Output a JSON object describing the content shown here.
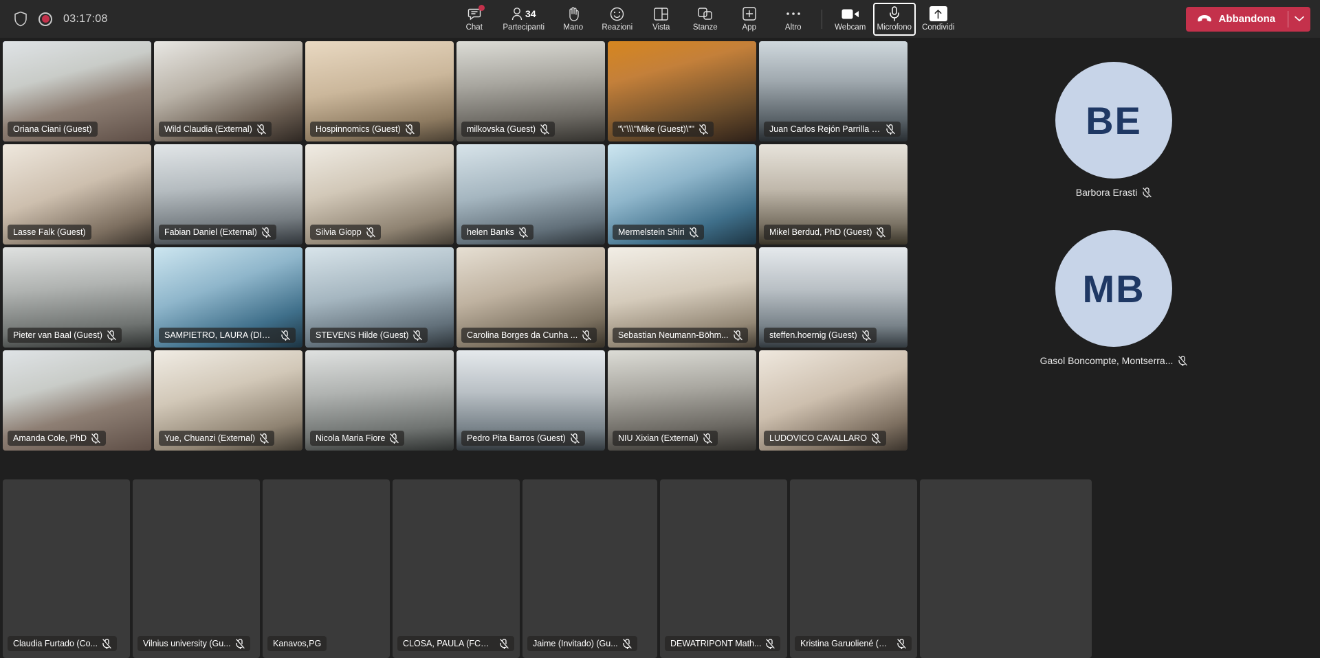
{
  "topbar": {
    "security_icon": "shield-icon",
    "recording_icon": "record-icon",
    "timer": "03:17:08",
    "buttons": [
      {
        "id": "chat",
        "label": "Chat",
        "icon": "chat-icon",
        "badge": true
      },
      {
        "id": "participants",
        "label": "Partecipanti",
        "icon": "people-icon",
        "count": "34"
      },
      {
        "id": "hand",
        "label": "Mano",
        "icon": "raise-hand-icon"
      },
      {
        "id": "reactions",
        "label": "Reazioni",
        "icon": "emoji-icon"
      },
      {
        "id": "view",
        "label": "Vista",
        "icon": "layout-grid-icon"
      },
      {
        "id": "rooms",
        "label": "Stanze",
        "icon": "breakout-rooms-icon"
      },
      {
        "id": "apps",
        "label": "App",
        "icon": "plus-box-icon"
      },
      {
        "id": "more",
        "label": "Altro",
        "icon": "ellipsis-icon"
      }
    ],
    "media": [
      {
        "id": "camera",
        "label": "Webcam",
        "icon": "video-camera-icon",
        "focused": false
      },
      {
        "id": "microphone",
        "label": "Microfono",
        "icon": "microphone-icon",
        "focused": true
      },
      {
        "id": "share",
        "label": "Condividi",
        "icon": "share-screen-icon",
        "focused": false
      }
    ],
    "leave": {
      "label": "Abbandona",
      "icon": "hangup-icon",
      "chevron": "chevron-down-icon",
      "color": "#c4314b"
    }
  },
  "grid": {
    "rows": [
      [
        {
          "name": "Oriana Ciani (Guest)",
          "muted": false,
          "active": true,
          "face": "f1"
        },
        {
          "name": "Wild Claudia (External)",
          "muted": true,
          "active": false,
          "face": "f2"
        },
        {
          "name": "Hospinnomics (Guest)",
          "muted": true,
          "active": false,
          "face": "f3"
        },
        {
          "name": "milkovska (Guest)",
          "muted": true,
          "active": false,
          "face": "f4"
        },
        {
          "name": "\"\\\"\\\\\\\"Mike (Guest)\\\"\"",
          "muted": true,
          "active": false,
          "face": "f5"
        },
        {
          "name": "Juan Carlos Rejón Parrilla (...",
          "muted": true,
          "active": false,
          "face": "f6"
        }
      ],
      [
        {
          "name": "Lasse Falk (Guest)",
          "muted": false,
          "active": false,
          "face": "f7"
        },
        {
          "name": "Fabian Daniel (External)",
          "muted": true,
          "active": false,
          "face": "f8"
        },
        {
          "name": "Silvia Giopp",
          "muted": true,
          "active": false,
          "face": "f9"
        },
        {
          "name": "helen Banks",
          "muted": true,
          "active": false,
          "face": "f10"
        },
        {
          "name": "Mermelstein Shiri",
          "muted": true,
          "active": false,
          "face": "f11"
        },
        {
          "name": "Mikel Berdud, PhD (Guest)",
          "muted": true,
          "active": false,
          "face": "f12"
        }
      ],
      [
        {
          "name": "Pieter van Baal (Guest)",
          "muted": true,
          "active": false,
          "face": "f13"
        },
        {
          "name": "SAMPIETRO, LAURA (DIRI...",
          "muted": true,
          "active": false,
          "face": "f11"
        },
        {
          "name": "STEVENS Hilde (Guest)",
          "muted": true,
          "active": false,
          "face": "f10"
        },
        {
          "name": "Carolina Borges da Cunha ...",
          "muted": true,
          "active": false,
          "face": "f14"
        },
        {
          "name": "Sebastian Neumann-Böhm...",
          "muted": true,
          "active": false,
          "face": "f15"
        },
        {
          "name": "steffen.hoernig (Guest)",
          "muted": true,
          "active": false,
          "face": "f16"
        }
      ],
      [
        {
          "name": "Amanda Cole, PhD",
          "muted": true,
          "active": false,
          "face": "f1"
        },
        {
          "name": "Yue, Chuanzi (External)",
          "muted": true,
          "active": false,
          "face": "f9"
        },
        {
          "name": "Nicola Maria Fiore",
          "muted": true,
          "active": false,
          "face": "f13"
        },
        {
          "name": "Pedro Pita Barros (Guest)",
          "muted": true,
          "active": false,
          "face": "f16"
        },
        {
          "name": "NIU Xixian (External)",
          "muted": true,
          "active": false,
          "face": "f4"
        },
        {
          "name": "LUDOVICO CAVALLARO",
          "muted": true,
          "active": false,
          "face": "f7"
        }
      ]
    ],
    "bottom_row": [
      {
        "name": "Claudia Furtado (Co...",
        "muted": true,
        "face": "f14"
      },
      {
        "name": "Vilnius university (Gu...",
        "muted": true,
        "face": "f15"
      },
      {
        "name": "Kanavos,PG",
        "muted": false,
        "face": "f3"
      },
      {
        "name": "CLOSA, PAULA (FCRB...",
        "muted": true,
        "face": "f9"
      },
      {
        "name": "Jaime (Invitado) (Gu...",
        "muted": true,
        "face": "f12"
      },
      {
        "name": "DEWATRIPONT Math...",
        "muted": true,
        "face": "f2"
      },
      {
        "name": "Kristina Garuoliené (Exter...",
        "muted": true,
        "face": "f8"
      },
      {
        "name": "",
        "muted": false,
        "face": "f1"
      }
    ]
  },
  "right_panel": {
    "avatars": [
      {
        "initials": "BE",
        "name": "Barbora Erasti",
        "muted": true,
        "bg": "#c7d4e8",
        "fg": "#1f3864"
      },
      {
        "initials": "MB",
        "name": "Gasol Boncompte, Montserra...",
        "muted": true,
        "bg": "#c7d4e8",
        "fg": "#1f3864"
      }
    ]
  }
}
